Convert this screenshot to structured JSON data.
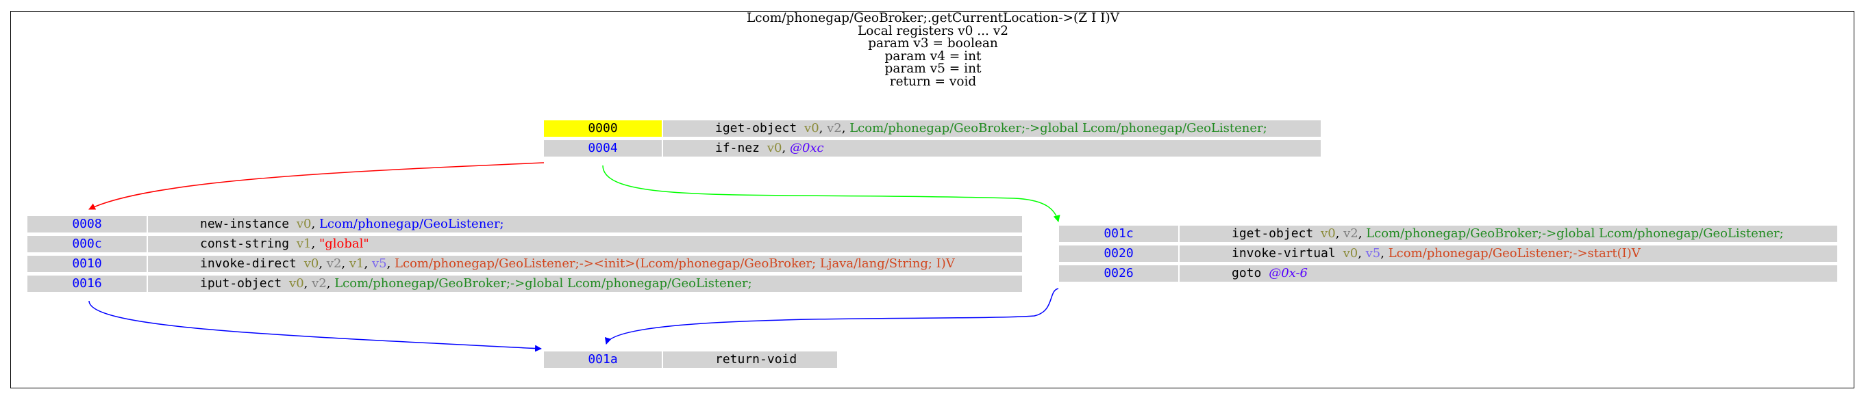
{
  "header": {
    "lines": [
      "Lcom/phonegap/GeoBroker;.getCurrentLocation->(Z I I)V",
      "Local registers v0 ... v2",
      "param v3 = boolean",
      "param v4 = int",
      "param v5 = int",
      "return = void"
    ]
  },
  "colors": {
    "highlight": "#ffff00",
    "cell_bg": "#d3d3d3",
    "address": "#0000ff",
    "edge_false": "#ff0000",
    "edge_true": "#00ff00",
    "edge_goto": "#0000ff"
  },
  "blocks": {
    "entry": {
      "rows": [
        {
          "addr": "0000",
          "highlight": true,
          "parts": [
            {
              "t": "iget-object ",
              "c": "op"
            },
            {
              "t": "v0",
              "c": "reg-a"
            },
            {
              "t": ", ",
              "c": ""
            },
            {
              "t": "v2",
              "c": "reg-b"
            },
            {
              "t": ", ",
              "c": ""
            },
            {
              "t": "Lcom/phonegap/GeoBroker;->global Lcom/phonegap/GeoListener;",
              "c": "fld"
            }
          ]
        },
        {
          "addr": "0004",
          "parts": [
            {
              "t": "if-nez ",
              "c": "op"
            },
            {
              "t": "v0",
              "c": "reg-a"
            },
            {
              "t": ", ",
              "c": ""
            },
            {
              "t": "@0xc",
              "c": "lbl"
            }
          ]
        }
      ]
    },
    "left": {
      "rows": [
        {
          "addr": "0008",
          "parts": [
            {
              "t": "new-instance ",
              "c": "op"
            },
            {
              "t": "v0",
              "c": "reg-a"
            },
            {
              "t": ", ",
              "c": ""
            },
            {
              "t": "Lcom/phonegap/GeoListener;",
              "c": "cls"
            }
          ]
        },
        {
          "addr": "000c",
          "parts": [
            {
              "t": "const-string ",
              "c": "op"
            },
            {
              "t": "v1",
              "c": "reg-a"
            },
            {
              "t": ", ",
              "c": ""
            },
            {
              "t": "\"global\"",
              "c": "str"
            }
          ]
        },
        {
          "addr": "0010",
          "parts": [
            {
              "t": "invoke-direct ",
              "c": "op"
            },
            {
              "t": "v0",
              "c": "reg-a"
            },
            {
              "t": ", ",
              "c": ""
            },
            {
              "t": "v2",
              "c": "reg-b"
            },
            {
              "t": ", ",
              "c": ""
            },
            {
              "t": "v1",
              "c": "reg-a"
            },
            {
              "t": ", ",
              "c": ""
            },
            {
              "t": "v5",
              "c": "reg-c"
            },
            {
              "t": ", ",
              "c": ""
            },
            {
              "t": "Lcom/phonegap/GeoListener;-><init>(Lcom/phonegap/GeoBroker; Ljava/lang/String; I)V",
              "c": "mth"
            }
          ]
        },
        {
          "addr": "0016",
          "parts": [
            {
              "t": "iput-object ",
              "c": "op"
            },
            {
              "t": "v0",
              "c": "reg-a"
            },
            {
              "t": ", ",
              "c": ""
            },
            {
              "t": "v2",
              "c": "reg-b"
            },
            {
              "t": ", ",
              "c": ""
            },
            {
              "t": "Lcom/phonegap/GeoBroker;->global Lcom/phonegap/GeoListener;",
              "c": "fld"
            }
          ]
        }
      ]
    },
    "right": {
      "rows": [
        {
          "addr": "001c",
          "parts": [
            {
              "t": "iget-object ",
              "c": "op"
            },
            {
              "t": "v0",
              "c": "reg-a"
            },
            {
              "t": ", ",
              "c": ""
            },
            {
              "t": "v2",
              "c": "reg-b"
            },
            {
              "t": ", ",
              "c": ""
            },
            {
              "t": "Lcom/phonegap/GeoBroker;->global Lcom/phonegap/GeoListener;",
              "c": "fld"
            }
          ]
        },
        {
          "addr": "0020",
          "parts": [
            {
              "t": "invoke-virtual ",
              "c": "op"
            },
            {
              "t": "v0",
              "c": "reg-a"
            },
            {
              "t": ", ",
              "c": ""
            },
            {
              "t": "v5",
              "c": "reg-c"
            },
            {
              "t": ", ",
              "c": ""
            },
            {
              "t": "Lcom/phonegap/GeoListener;->start(I)V",
              "c": "mth"
            }
          ]
        },
        {
          "addr": "0026",
          "parts": [
            {
              "t": "goto ",
              "c": "op"
            },
            {
              "t": "@0x-6",
              "c": "lbl"
            }
          ]
        }
      ]
    },
    "exit": {
      "rows": [
        {
          "addr": "001a",
          "parts": [
            {
              "t": "return-void",
              "c": "op"
            }
          ]
        }
      ]
    }
  }
}
